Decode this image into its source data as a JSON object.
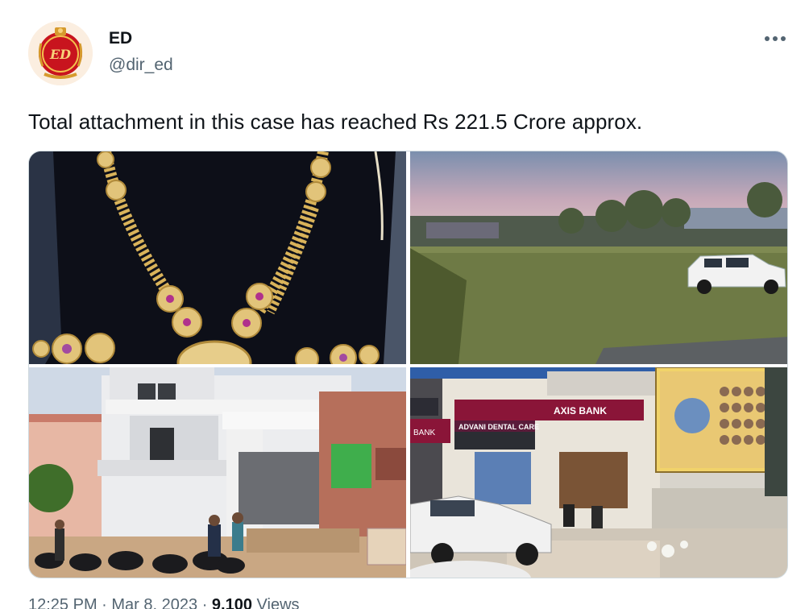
{
  "author": {
    "name": "ED",
    "handle": "@dir_ed",
    "avatar_icon": "ed-logo-emblem-icon"
  },
  "more_icon": "more-dots-icon",
  "tweet": {
    "text": "Total attachment in this case has reached Rs 221.5 Crore approx."
  },
  "media": {
    "count": 4,
    "images": [
      {
        "subject": "gold necklace with purple stones on black display",
        "signs": []
      },
      {
        "subject": "open land plot with parked white SUV",
        "signs": []
      },
      {
        "subject": "multi-storey residential house under construction with motorcycles",
        "signs": []
      },
      {
        "subject": "commercial building street front",
        "signs": [
          "AXIS BANK",
          "ADVANI DENTAL CARE",
          "BANK"
        ]
      }
    ]
  },
  "meta": {
    "time": "12:25 PM",
    "date": "Mar 8, 2023",
    "views": "9,100",
    "views_label": "Views"
  },
  "colors": {
    "text": "#0f1419",
    "secondary": "#536471",
    "border": "#cfd9de",
    "bank_brand": "#8a1538"
  }
}
